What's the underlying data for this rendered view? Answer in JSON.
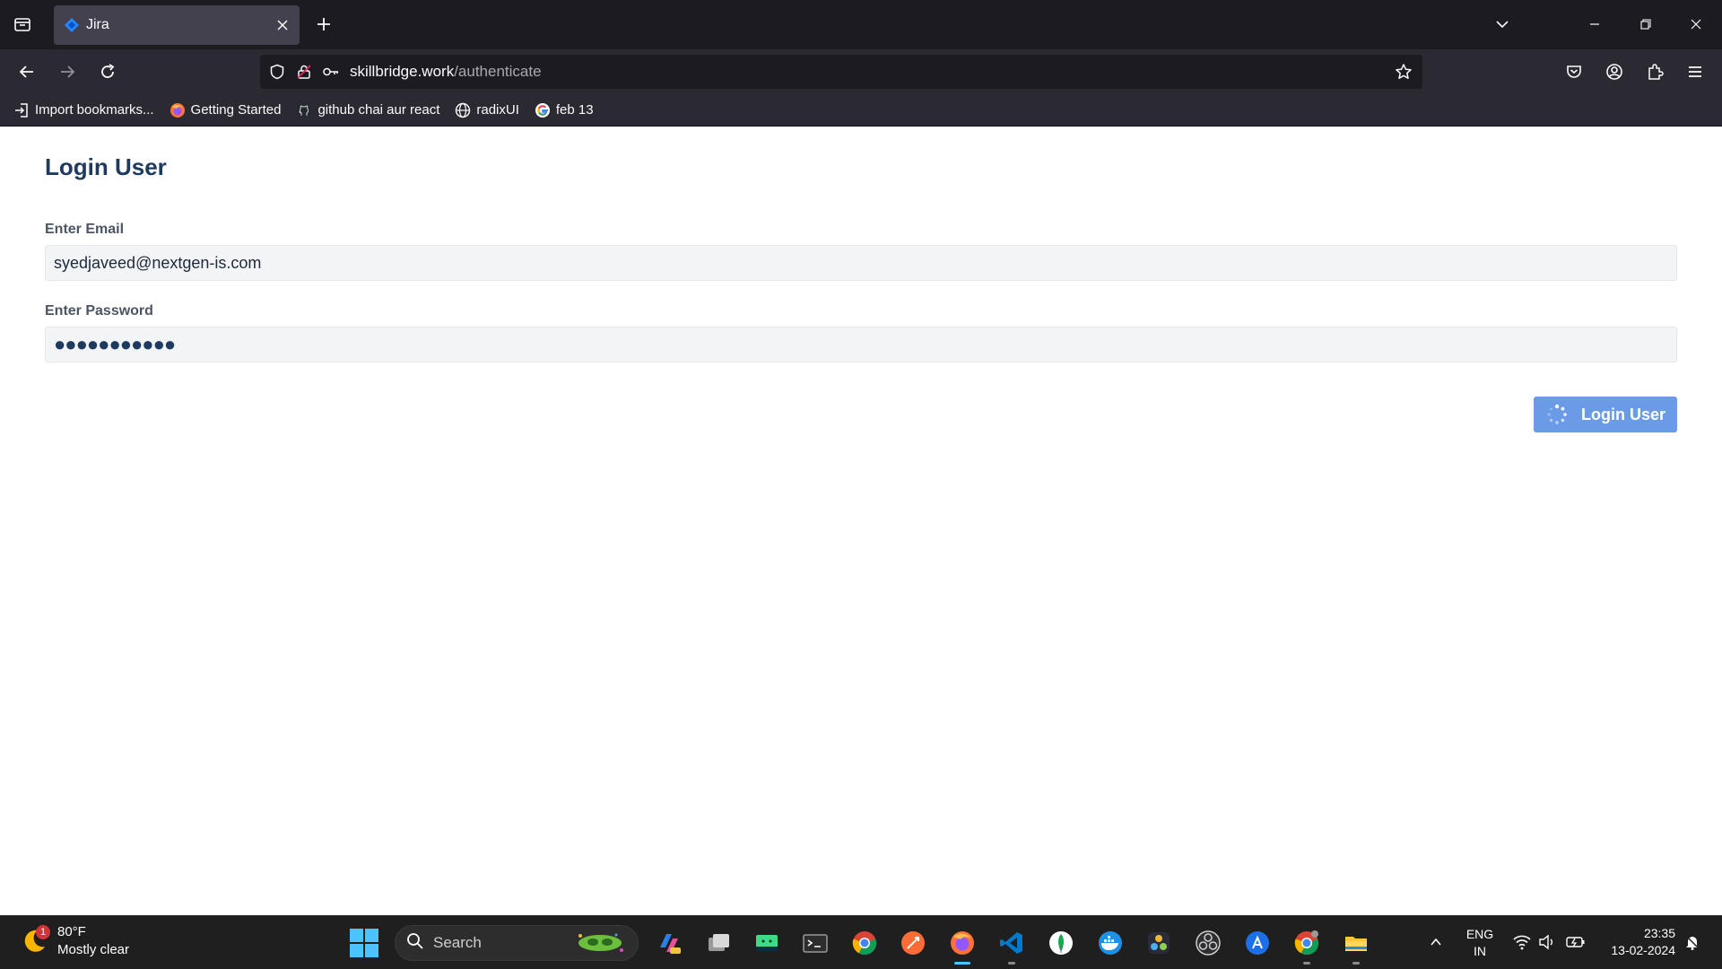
{
  "browser": {
    "tab": {
      "title": "Jira"
    },
    "url": {
      "host": "skillbridge.work",
      "path": "/authenticate"
    },
    "bookmarks": [
      {
        "label": "Import bookmarks...",
        "icon": "import-icon"
      },
      {
        "label": "Getting Started",
        "icon": "firefox-icon"
      },
      {
        "label": "github chai aur react",
        "icon": "github-icon"
      },
      {
        "label": "radixUI",
        "icon": "globe-icon"
      },
      {
        "label": "feb 13",
        "icon": "google-icon"
      }
    ]
  },
  "page": {
    "title": "Login User",
    "email_label": "Enter Email",
    "email_value": "syedjaveed@nextgen-is.com",
    "password_label": "Enter Password",
    "password_mask": "●●●●●●●●●●●",
    "submit_label": "Login User",
    "submit_loading": true
  },
  "taskbar": {
    "weather": {
      "temp": "80°F",
      "condition": "Mostly clear",
      "badge": "1"
    },
    "search_label": "Search",
    "apps": [
      "copilot-icon",
      "task-view-icon",
      "android-studio-icon",
      "terminal-icon",
      "chrome-icon",
      "postman-icon",
      "firefox-icon",
      "vscode-icon",
      "mongodb-icon",
      "docker-icon",
      "davinci-resolve-icon",
      "obs-icon",
      "app-store-icon",
      "chrome-beta-icon",
      "file-explorer-icon"
    ],
    "lang": {
      "line1": "ENG",
      "line2": "IN"
    },
    "clock": {
      "time": "23:35",
      "date": "13-02-2024"
    }
  },
  "colors": {
    "accent": "#6b9be6",
    "title": "#1e3a5f",
    "chrome_dark": "#1c1b22",
    "chrome": "#2b2a33"
  }
}
